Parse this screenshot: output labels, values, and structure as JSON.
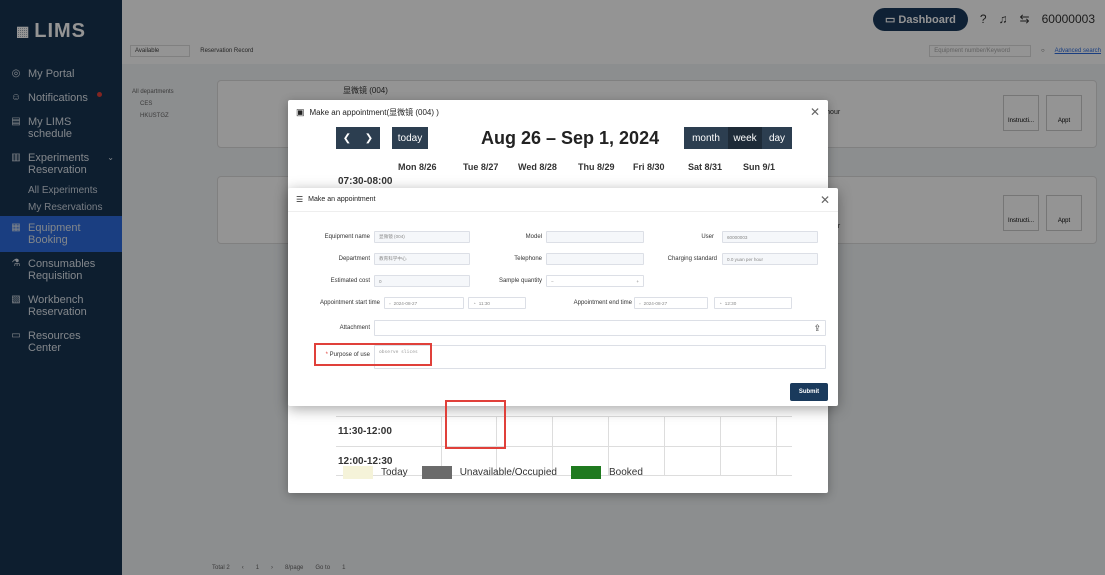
{
  "app": {
    "logo": "LIMS"
  },
  "sidebar": {
    "items": [
      {
        "label": "My Portal",
        "icon": "portal-icon"
      },
      {
        "label": "Notifications",
        "icon": "bell-icon"
      },
      {
        "label": "My LIMS schedule",
        "icon": "calendar-icon"
      },
      {
        "label": "Experiments Reservation",
        "icon": "flask-icon"
      },
      {
        "label": "Equipment Booking",
        "icon": "equipment-icon"
      },
      {
        "label": "Consumables Requisition",
        "icon": "consumables-icon"
      },
      {
        "label": "Workbench Reservation",
        "icon": "workbench-icon"
      },
      {
        "label": "Resources Center",
        "icon": "resources-icon"
      }
    ],
    "sub": [
      "All Experiments",
      "My Reservations"
    ]
  },
  "topbar": {
    "dashboard": "Dashboard",
    "user": "60000003"
  },
  "content": {
    "filter_available": "Available",
    "reservation_record": "Reservation Record",
    "search_placeholder": "Equipment number/Keyword",
    "advanced_search": "Advanced search",
    "tree": [
      "All departments",
      "CES",
      "HKUSTGZ"
    ],
    "card_rate": "er hour",
    "card_btn1": "Instructi...",
    "card_btn2": "Appt",
    "pager": {
      "total": "Total 2",
      "page": "1",
      "per": "8/page",
      "goto": "Go to",
      "goto_val": "1"
    },
    "card_peek": "显微镜 (004)"
  },
  "dialog_calendar": {
    "title": "Make an appointment(显微镜 (004) )",
    "today": "today",
    "range": "Aug 26 – Sep 1, 2024",
    "views": [
      "month",
      "week",
      "day"
    ],
    "days": [
      "Mon 8/26",
      "Tue 8/27",
      "Wed 8/28",
      "Thu 8/29",
      "Fri 8/30",
      "Sat 8/31",
      "Sun 9/1"
    ],
    "slots": [
      "07:30-08:00",
      "11:30-12:00",
      "12:00-12:30"
    ],
    "legend": [
      "Today",
      "Unavailable/Occupied",
      "Booked"
    ],
    "legend_colors": [
      "#f5f3d9",
      "#6b6b6b",
      "#1f7a1f"
    ]
  },
  "dialog_form": {
    "title": "Make an appointment",
    "fields": {
      "equipment_name": {
        "label": "Equipment name",
        "value": "显微镜 (004)"
      },
      "model": {
        "label": "Model",
        "value": ""
      },
      "user": {
        "label": "User",
        "value": "60000003"
      },
      "department": {
        "label": "Department",
        "value": "教育科学中心"
      },
      "telephone": {
        "label": "Telephone",
        "value": ""
      },
      "charging": {
        "label": "Charging standard",
        "value": "0.0 yuan per hour"
      },
      "cost": {
        "label": "Estimated cost",
        "value": "0"
      },
      "sample": {
        "label": "Sample quantity",
        "minus": "−",
        "plus": "+"
      },
      "start": {
        "label": "Appointment start time",
        "date": "2024-08-27",
        "time": "11:30"
      },
      "end": {
        "label": "Appointment end time",
        "date": "2024-08-27",
        "time": "12:30"
      },
      "attachment": {
        "label": "Attachment"
      },
      "purpose": {
        "label": "Purpose of use",
        "value": "observe slices",
        "required": "*"
      }
    },
    "submit": "Submit"
  }
}
